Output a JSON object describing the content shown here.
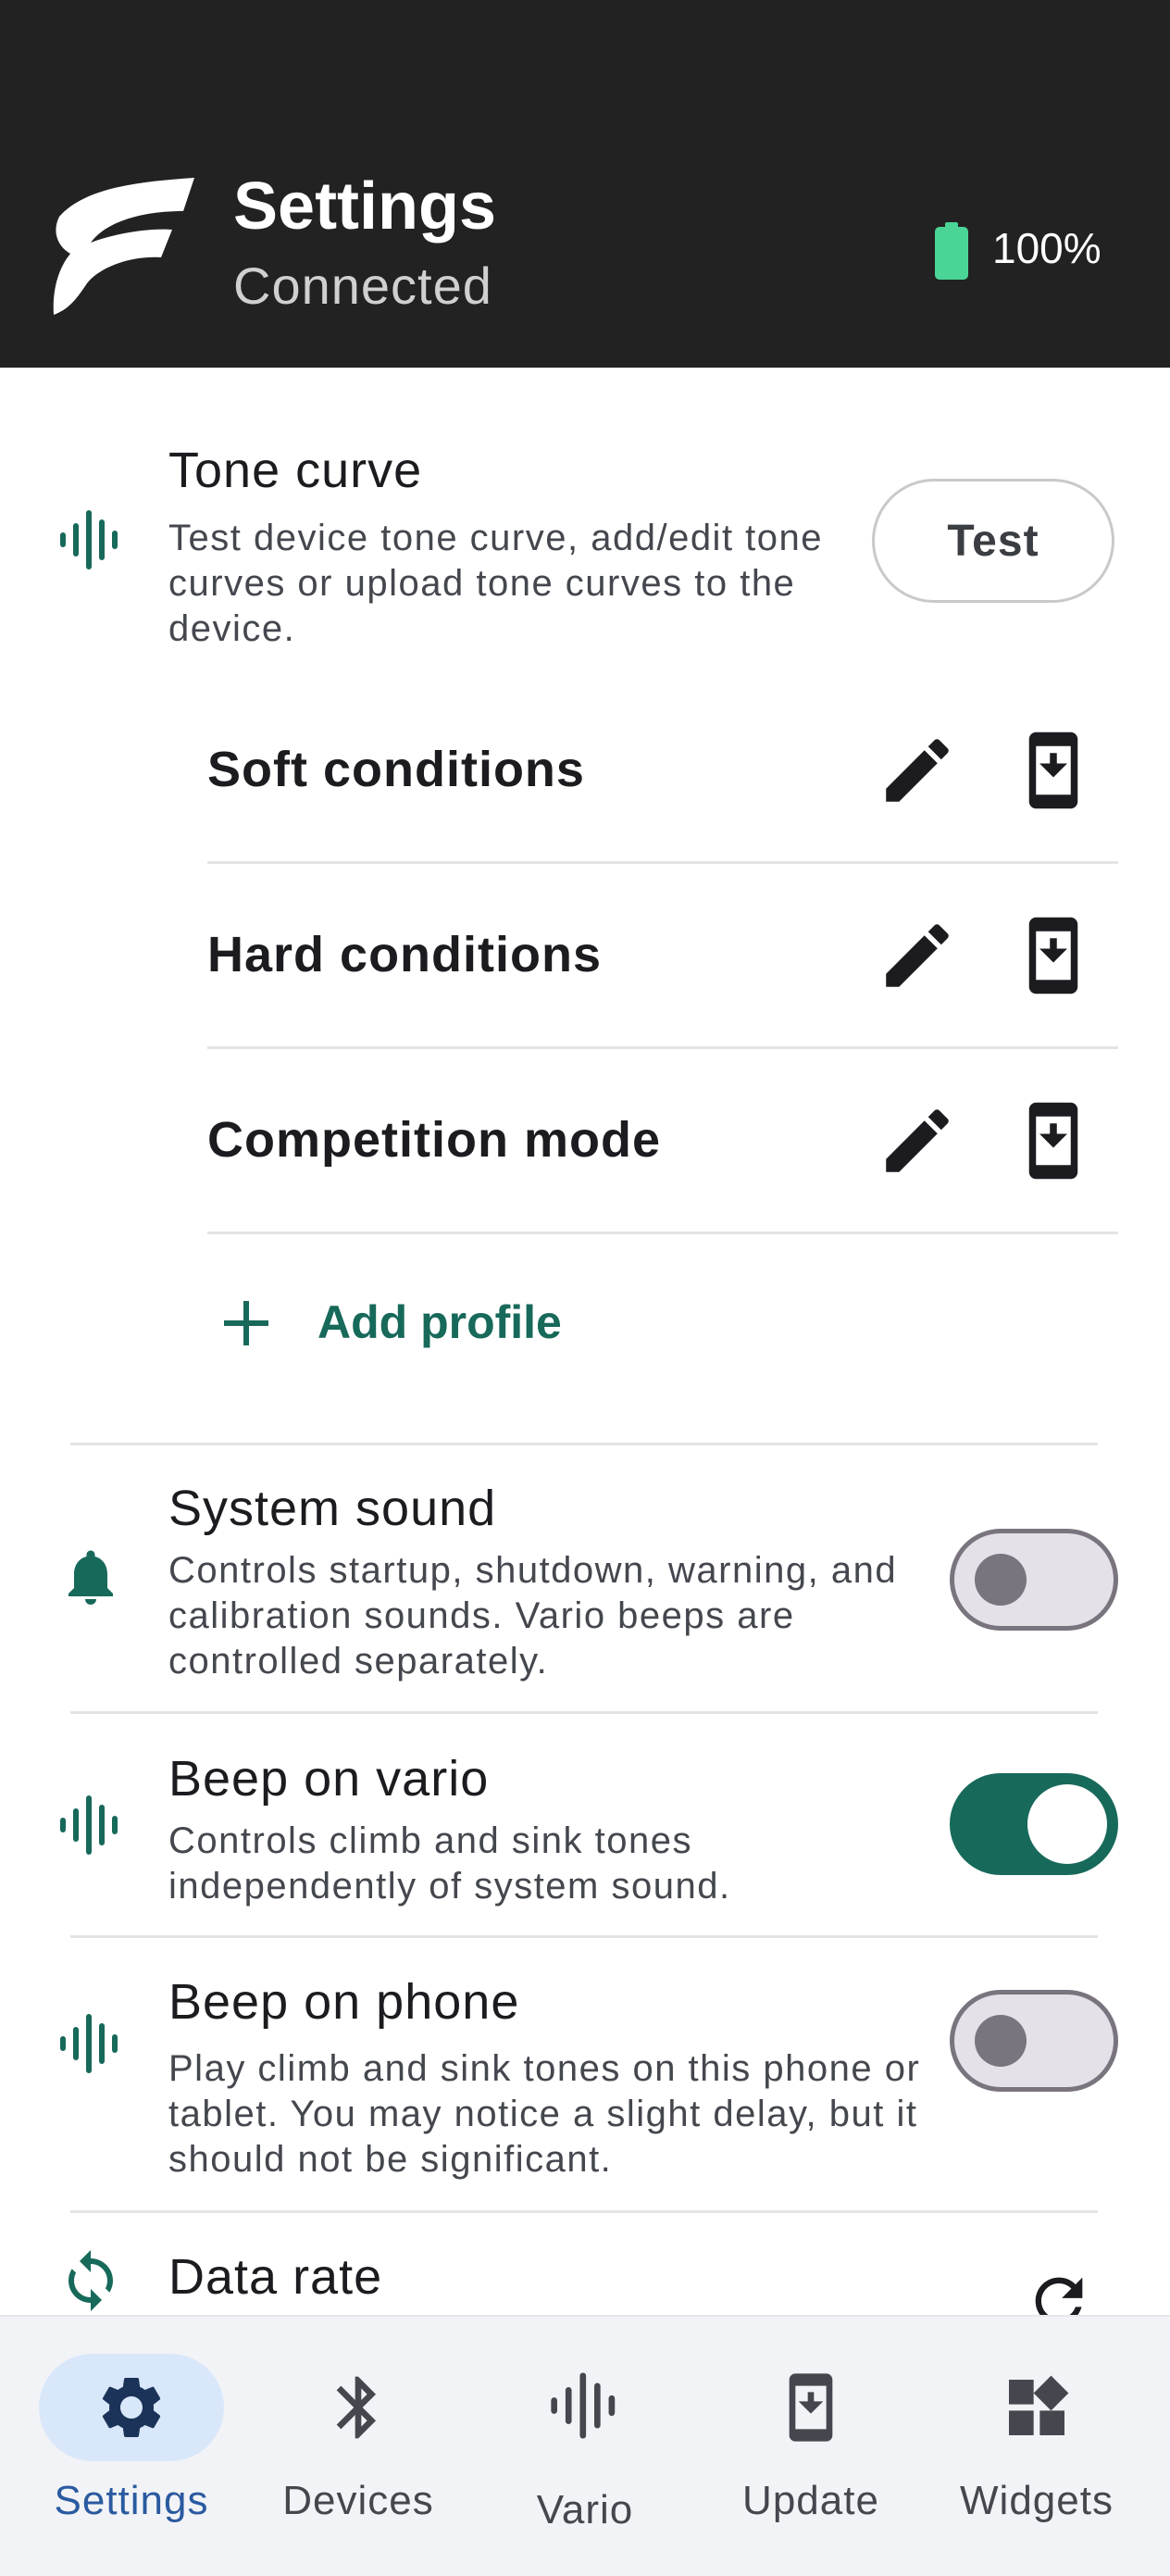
{
  "header": {
    "title": "Settings",
    "status": "Connected",
    "battery": "100%",
    "battery_color": "#4ad597",
    "logo_icon": "brand-logo"
  },
  "tone_curve": {
    "title": "Tone curve",
    "description": "Test device tone curve, add/edit tone curves or upload tone curves to the device.",
    "test_button": "Test",
    "icon": "waveform-icon",
    "profiles": [
      {
        "name": "Soft conditions"
      },
      {
        "name": "Hard conditions"
      },
      {
        "name": "Competition mode"
      }
    ],
    "add_profile_label": "Add profile"
  },
  "settings": [
    {
      "title": "System sound",
      "description": "Controls startup, shutdown, warning, and calibration sounds. Vario beeps are controlled separately.",
      "icon": "bell-icon",
      "enabled": false
    },
    {
      "title": "Beep on vario",
      "description": "Controls climb and sink tones independently of system sound.",
      "icon": "waveform-icon",
      "enabled": true
    },
    {
      "title": "Beep on phone",
      "description": "Play climb and sink tones on this phone or tablet. You may notice a slight delay, but it should not be significant.",
      "icon": "waveform-icon",
      "enabled": false
    },
    {
      "title": "Data rate",
      "icon": "sync-icon"
    }
  ],
  "nav": {
    "active": "Settings",
    "items": [
      {
        "label": "Settings",
        "icon": "gear-icon"
      },
      {
        "label": "Devices",
        "icon": "bluetooth-icon"
      },
      {
        "label": "Vario",
        "icon": "waveform-icon"
      },
      {
        "label": "Update",
        "icon": "phone-download-icon"
      },
      {
        "label": "Widgets",
        "icon": "widgets-icon"
      }
    ]
  },
  "colors": {
    "accent": "#17695a",
    "header_bg": "#222222",
    "nav_active_pill": "#d9e7fb",
    "nav_active_text": "#2a5aa0"
  }
}
